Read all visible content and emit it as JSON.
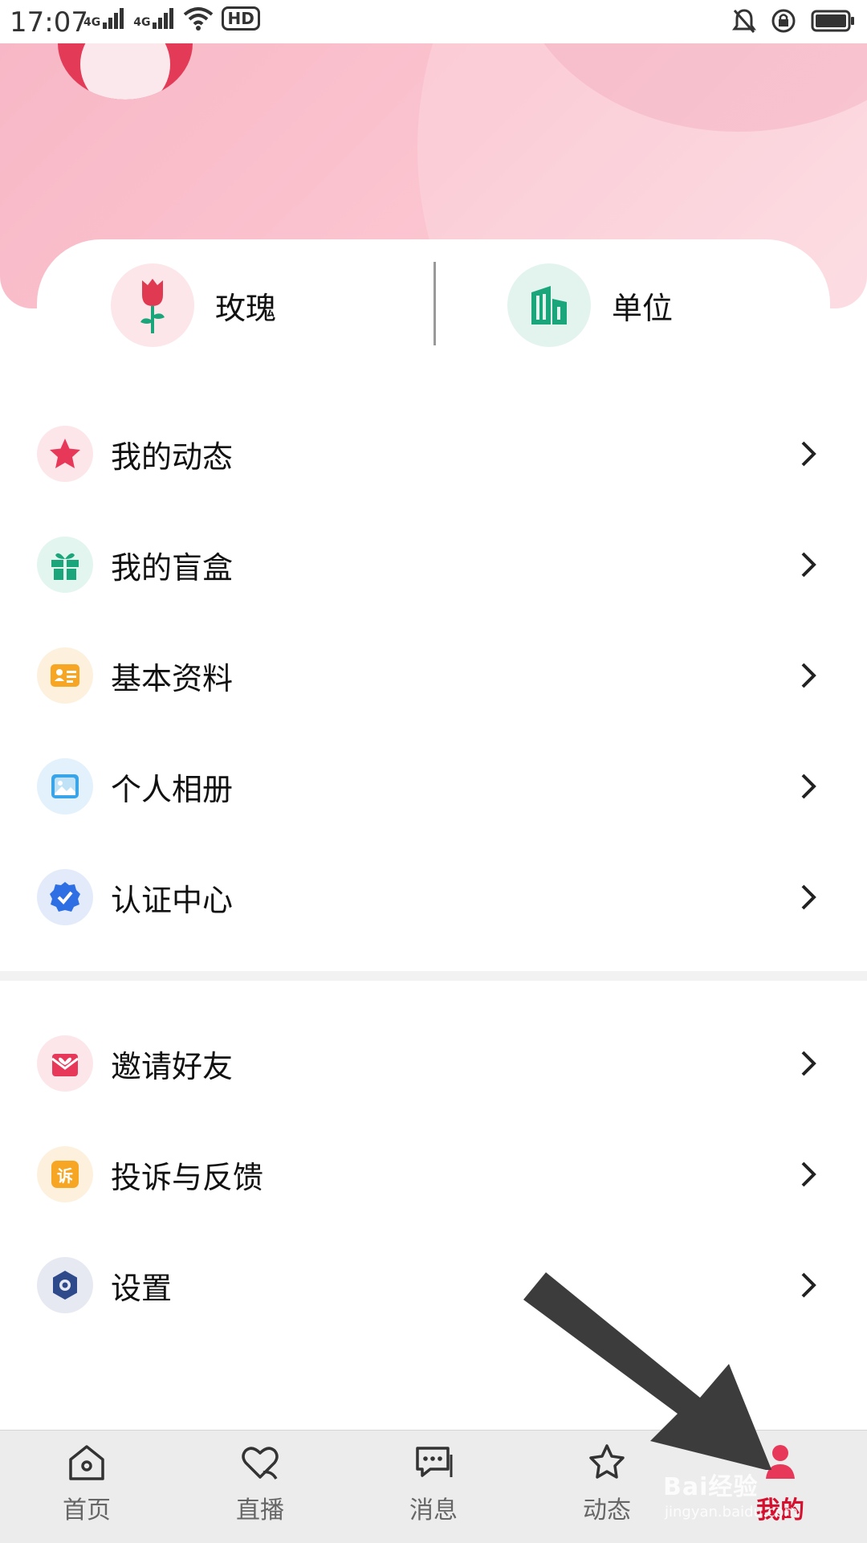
{
  "status_bar": {
    "time": "17:07",
    "net1": "4G",
    "net2": "4G",
    "hd": "HD"
  },
  "quick": {
    "rose_label": "玫瑰",
    "unit_label": "单位"
  },
  "menu_group1": [
    {
      "label": "我的动态",
      "icon": "star-icon",
      "color": "#e8385a"
    },
    {
      "label": "我的盲盒",
      "icon": "gift-icon",
      "color": "#1aa57a"
    },
    {
      "label": "基本资料",
      "icon": "id-card-icon",
      "color": "#f6a623"
    },
    {
      "label": "个人相册",
      "icon": "photo-icon",
      "color": "#3aa4e8"
    },
    {
      "label": "认证中心",
      "icon": "verified-badge-icon",
      "color": "#2f6fe4"
    }
  ],
  "menu_group2": [
    {
      "label": "邀请好友",
      "icon": "invite-envelope-icon",
      "color": "#e8385a"
    },
    {
      "label": "投诉与反馈",
      "icon": "complaint-icon",
      "color": "#f6a623",
      "icon_text": "诉"
    },
    {
      "label": "设置",
      "icon": "settings-icon",
      "color": "#2f4a8a"
    }
  ],
  "bottom_nav": {
    "home": "首页",
    "live": "直播",
    "messages": "消息",
    "moments": "动态",
    "mine": "我的"
  },
  "watermark": {
    "main": "Bai经验",
    "sub": "jingyan.baidu.com"
  },
  "colors": {
    "accent": "#d6102f",
    "header_pink": "#f8b7c6"
  }
}
